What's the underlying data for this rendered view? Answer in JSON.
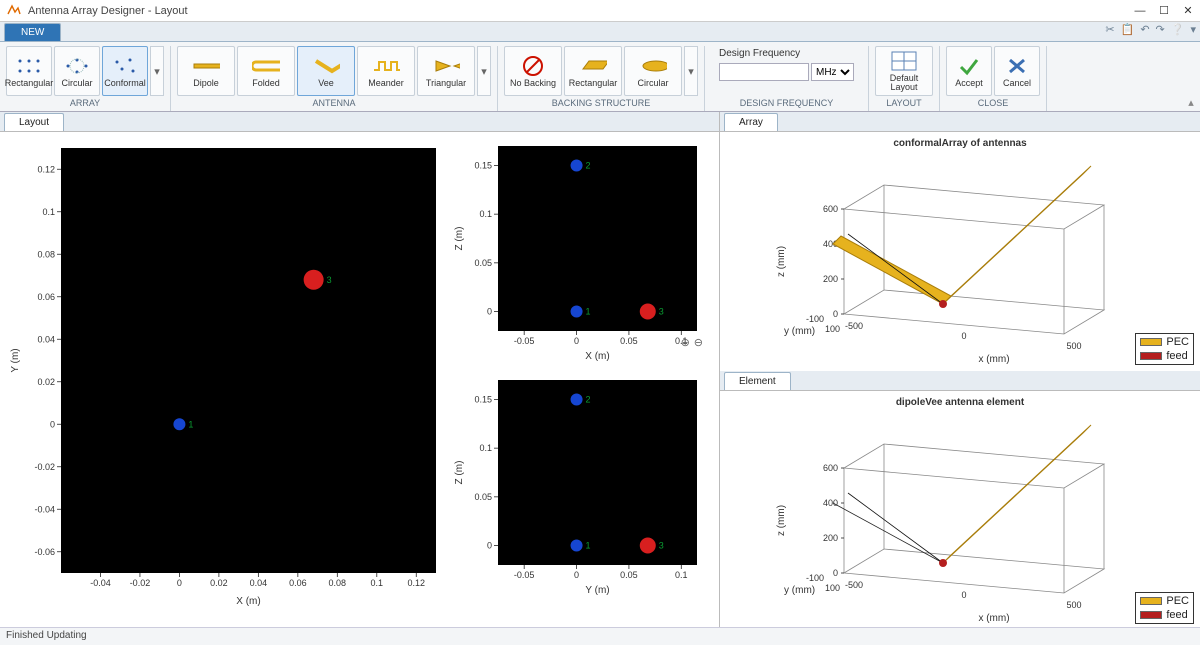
{
  "window": {
    "title": "Antenna Array Designer - Layout"
  },
  "ribbon": {
    "tab_new": "NEW",
    "group_array": "ARRAY",
    "group_antenna": "ANTENNA",
    "group_backing": "BACKING STRUCTURE",
    "group_freq": "DESIGN FREQUENCY",
    "group_layout": "LAYOUT",
    "group_close": "CLOSE",
    "btn_rectangular": "Rectangular",
    "btn_circular": "Circular",
    "btn_conformal": "Conformal",
    "btn_dipole": "Dipole",
    "btn_folded": "Folded",
    "btn_vee": "Vee",
    "btn_meander": "Meander",
    "btn_triangular": "Triangular",
    "btn_nobacking": "No Backing",
    "btn_rect_backing": "Rectangular",
    "btn_circ_backing": "Circular",
    "freq_label": "Design Frequency",
    "freq_value": "",
    "freq_unit": "MHz",
    "btn_default_layout": "Default Layout",
    "btn_accept": "Accept",
    "btn_cancel": "Cancel"
  },
  "tabs": {
    "layout": "Layout",
    "array": "Array",
    "element": "Element"
  },
  "plots3d": {
    "array_title": "conformalArray of antennas",
    "element_title": "dipoleVee antenna element",
    "xlabel": "x (mm)",
    "ylabel": "y (mm)",
    "zlabel": "z (mm)",
    "legend_pec": "PEC",
    "legend_feed": "feed"
  },
  "status": "Finished Updating",
  "colors": {
    "blue": "#1646d1",
    "red": "#d81f1f",
    "gold": "#e6b21e",
    "feed": "#b41f1f",
    "grid": "#e0e0e0"
  },
  "chart_data": [
    {
      "type": "scatter",
      "name": "layout_xy",
      "xlabel": "X (m)",
      "ylabel": "Y (m)",
      "xlim": [
        -0.06,
        0.13
      ],
      "ylim": [
        -0.07,
        0.13
      ],
      "xticks": [
        -0.04,
        -0.02,
        0,
        0.02,
        0.04,
        0.06,
        0.08,
        0.1,
        0.12
      ],
      "yticks": [
        -0.06,
        -0.04,
        -0.02,
        0,
        0.02,
        0.04,
        0.06,
        0.08,
        0.1,
        0.12
      ],
      "points": [
        {
          "id": "1",
          "x": 0.0,
          "y": 0.0,
          "color": "blue",
          "r": 6
        },
        {
          "id": "3",
          "x": 0.068,
          "y": 0.068,
          "color": "red",
          "r": 10
        }
      ]
    },
    {
      "type": "scatter",
      "name": "layout_xz",
      "xlabel": "X (m)",
      "ylabel": "Z (m)",
      "xlim": [
        -0.075,
        0.115
      ],
      "ylim": [
        -0.02,
        0.17
      ],
      "xticks": [
        -0.05,
        0,
        0.05,
        0.1
      ],
      "yticks": [
        0,
        0.05,
        0.1,
        0.15
      ],
      "points": [
        {
          "id": "2",
          "x": 0.0,
          "y": 0.15,
          "color": "blue",
          "r": 6
        },
        {
          "id": "1",
          "x": 0.0,
          "y": 0.0,
          "color": "blue",
          "r": 6
        },
        {
          "id": "3",
          "x": 0.068,
          "y": 0.0,
          "color": "red",
          "r": 8
        }
      ]
    },
    {
      "type": "scatter",
      "name": "layout_yz",
      "xlabel": "Y (m)",
      "ylabel": "Z (m)",
      "xlim": [
        -0.075,
        0.115
      ],
      "ylim": [
        -0.02,
        0.17
      ],
      "xticks": [
        -0.05,
        0,
        0.05,
        0.1
      ],
      "yticks": [
        0,
        0.05,
        0.1,
        0.15
      ],
      "points": [
        {
          "id": "2",
          "x": 0.0,
          "y": 0.15,
          "color": "blue",
          "r": 6
        },
        {
          "id": "1",
          "x": 0.0,
          "y": 0.0,
          "color": "blue",
          "r": 6
        },
        {
          "id": "3",
          "x": 0.068,
          "y": 0.0,
          "color": "red",
          "r": 8
        }
      ]
    },
    {
      "type": "3d",
      "name": "array_3d",
      "xlabel": "x (mm)",
      "ylabel": "y (mm)",
      "zlabel": "z (mm)",
      "xticks": [
        -500,
        0,
        500
      ],
      "yticks": [
        -100,
        100
      ],
      "zticks": [
        0,
        200,
        400,
        600
      ]
    },
    {
      "type": "3d",
      "name": "element_3d",
      "xlabel": "x (mm)",
      "ylabel": "y (mm)",
      "zlabel": "z (mm)",
      "xticks": [
        -500,
        0,
        500
      ],
      "yticks": [
        -100,
        100
      ],
      "zticks": [
        0,
        200,
        400,
        600
      ]
    }
  ]
}
